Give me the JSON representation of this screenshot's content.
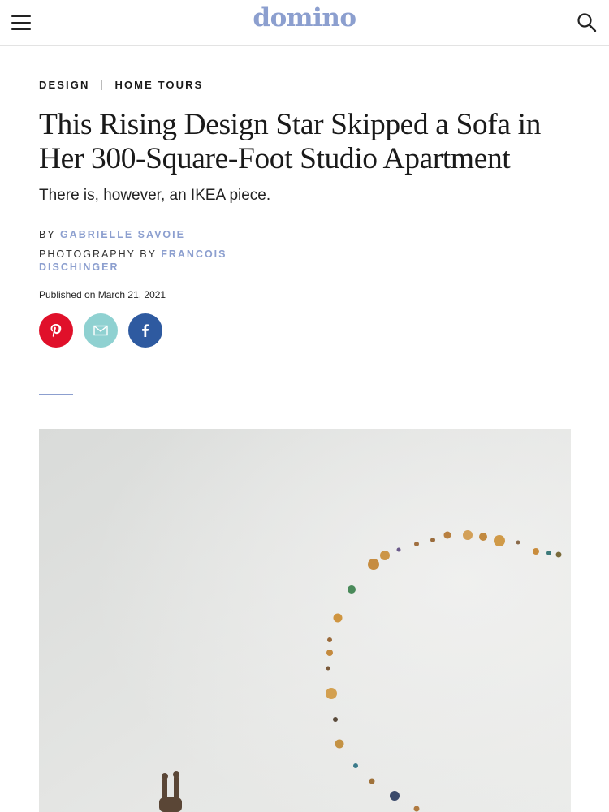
{
  "header": {
    "logo_text": "domino",
    "menu_icon": "hamburger-menu-icon",
    "search_icon": "search-icon"
  },
  "article": {
    "categories": [
      "DESIGN",
      "HOME TOURS"
    ],
    "title": "This Rising Design Star Skipped a Sofa in Her 300-Square-Foot Studio Apartment",
    "subtitle": "There is, however, an IKEA piece.",
    "byline_prefix": "BY",
    "author": "GABRIELLE SAVOIE",
    "photo_prefix": "PHOTOGRAPHY BY",
    "photographer": "FRANCOIS DISCHINGER",
    "published": "Published on March 21, 2021"
  },
  "share": [
    {
      "icon": "pinterest-icon",
      "color": "#e0102a"
    },
    {
      "icon": "email-icon",
      "color": "#8fd1d1"
    },
    {
      "icon": "facebook-icon",
      "color": "#2e5aa0"
    }
  ],
  "colors": {
    "brand": "#8c9fcf",
    "text": "#1a1a1a"
  },
  "hero_image": {
    "icon": "hero-photo"
  }
}
